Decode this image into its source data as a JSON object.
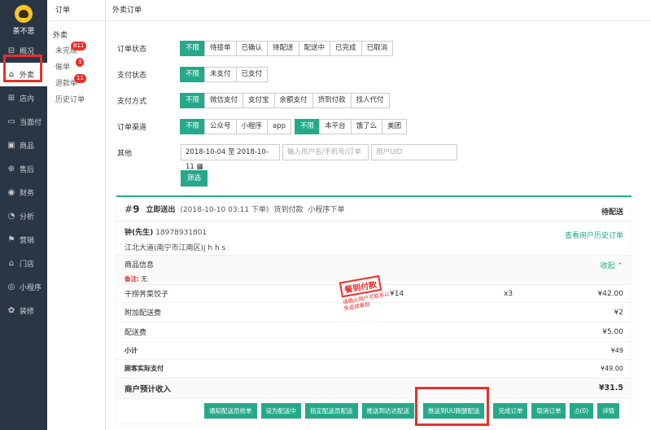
{
  "brand": {
    "name": "茶不思"
  },
  "sidebar": {
    "items": [
      {
        "label": "概况",
        "icon": "overview-icon"
      },
      {
        "label": "外卖",
        "icon": "takeout-icon"
      },
      {
        "label": "店内",
        "icon": "store-icon"
      },
      {
        "label": "当面付",
        "icon": "wallet-icon"
      },
      {
        "label": "商品",
        "icon": "goods-icon"
      },
      {
        "label": "售后",
        "icon": "aftersale-icon"
      },
      {
        "label": "财务",
        "icon": "finance-icon"
      },
      {
        "label": "分析",
        "icon": "analysis-icon"
      },
      {
        "label": "营销",
        "icon": "marketing-icon"
      },
      {
        "label": "门店",
        "icon": "shop-icon"
      },
      {
        "label": "小程序",
        "icon": "miniprogram-icon"
      },
      {
        "label": "装修",
        "icon": "decorate-icon"
      }
    ]
  },
  "submenu": {
    "title": "订单",
    "group": "外卖",
    "items": [
      {
        "label": "未完成",
        "badge": "811"
      },
      {
        "label": "催单",
        "badge": "3"
      },
      {
        "label": "退款单",
        "badge": "11"
      },
      {
        "label": "历史订单",
        "badge": ""
      }
    ]
  },
  "main": {
    "title": "外卖订单"
  },
  "filters": {
    "order_status": {
      "label": "订单状态",
      "options": [
        "不限",
        "待接单",
        "已确认",
        "待配送",
        "配送中",
        "已完成",
        "已取消"
      ]
    },
    "pay_status": {
      "label": "支付状态",
      "options": [
        "不限",
        "未支付",
        "已支付"
      ]
    },
    "pay_method": {
      "label": "支付方式",
      "options": [
        "不限",
        "微信支付",
        "支付宝",
        "余额支付",
        "货到付款",
        "找人代付"
      ]
    },
    "channel": {
      "label": "订单渠道",
      "options_a": [
        "不限",
        "公众号",
        "小程序",
        "app"
      ],
      "options_b": [
        "不限",
        "本平台",
        "饿了么",
        "美团"
      ]
    },
    "other": {
      "label": "其他",
      "date_range": "2018-10-04 至 2018-10-11",
      "search_placeholder": "输入用户名/手机号/订单",
      "uid_placeholder": "用户UID"
    },
    "filter_button": "筛选"
  },
  "order": {
    "number": "9",
    "type": "立即送出",
    "time": "(2018-10-10 03:11 下单)",
    "pay": "货到付款",
    "source": "小程序下单",
    "status": "待配送",
    "customer": {
      "name": "钟(先生)",
      "phone": "18978931801",
      "address": "江北大道(南宁市江南区)j h h s"
    },
    "history_link": "查看用户历史订单",
    "goods_title": "商品信息",
    "remark_label": "备注:",
    "remark_value": "无",
    "collapse": "收起",
    "stamp": {
      "title": "餐到付款",
      "text": "请确认用户可联系以免造成餐损"
    },
    "item": {
      "name": "干捞荠菜饺子",
      "price": "¥14",
      "qty": "x3",
      "total": "¥42.00"
    },
    "extra_fee": {
      "label": "附加配送费",
      "value": "¥2"
    },
    "delivery_fee": {
      "label": "配送费",
      "value": "¥5.00"
    },
    "subtotal": {
      "label": "小计",
      "value": "¥49"
    },
    "paid": {
      "label": "顾客实际支付",
      "value": "¥49.00"
    },
    "income": {
      "label": "商户预计收入",
      "value": "¥31.5"
    },
    "actions": [
      "通知配送员抢单",
      "设为配送中",
      "指定配送员配送",
      "推送到达达配送",
      "推送到UU跑腿配送",
      "完成订单",
      "取消订单",
      "(0)",
      "详情"
    ]
  }
}
